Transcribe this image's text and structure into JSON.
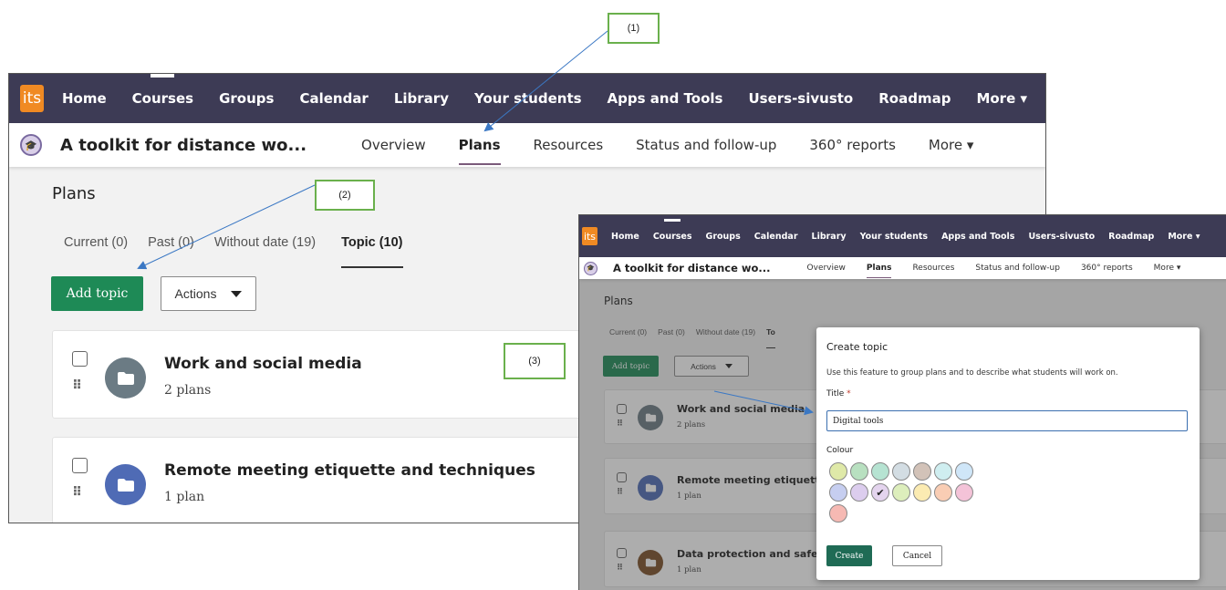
{
  "app": {
    "logo_text": "its",
    "nav": [
      "Home",
      "Courses",
      "Groups",
      "Calendar",
      "Library",
      "Your students",
      "Apps and Tools",
      "Users-sivusto",
      "Roadmap",
      "More ▾"
    ],
    "nav_active_index": 1,
    "course_title": "A toolkit for distance wo...",
    "course_nav": [
      "Overview",
      "Plans",
      "Resources",
      "Status and follow-up",
      "360° reports",
      "More ▾"
    ],
    "course_nav_active_index": 1,
    "page_heading": "Plans",
    "tabs": [
      "Current (0)",
      "Past (0)",
      "Without date (19)",
      "Topic (10)"
    ],
    "tabs_active_index": 3,
    "add_topic_label": "Add topic",
    "actions_label": "Actions",
    "topics": [
      {
        "title": "Work and social media",
        "count": "2 plans",
        "color": "#6b7b84"
      },
      {
        "title": "Remote meeting etiquette and techniques",
        "count": "1 plan",
        "color": "#4f6bb5"
      },
      {
        "title": "Data protection and safety",
        "count": "1 plan",
        "color": "#7a4e26"
      }
    ],
    "topics_dialog_view": [
      {
        "title": "Work and social media",
        "count": "2 plans"
      },
      {
        "title": "Remote meeting etiquette a",
        "count": "1 plan"
      },
      {
        "title": "Data protection and safety",
        "count": "1 plan"
      }
    ],
    "tabs_dialog_view": [
      "Current (0)",
      "Past (0)",
      "Without date (19)",
      "To"
    ]
  },
  "callouts": {
    "one": "(1)",
    "two": "(2)",
    "three": "(3)"
  },
  "dialog": {
    "title": "Create topic",
    "description": "Use this feature to group plans and to describe what students will work on.",
    "title_label": "Title",
    "required_mark": "*",
    "title_value": "Digital tools",
    "colour_label": "Colour",
    "swatch_colors": [
      "#dfe9a8",
      "#b8e0c0",
      "#b6e3d2",
      "#d3dde3",
      "#d2c2b8",
      "#cfeef0",
      "#cfe6f8",
      "#c6cef0",
      "#dccdee",
      "#e4d4ee",
      "#ddeebc",
      "#fbebb2",
      "#f9cdb4",
      "#f4c3d8",
      "#f6b9b3"
    ],
    "selected_swatch_index": 9,
    "check_mark": "✔",
    "create_label": "Create",
    "cancel_label": "Cancel"
  },
  "colors": {
    "topnav_bg": "#3d3b55",
    "logo_bg": "#f08a23",
    "primary_green": "#1e8a56",
    "callout_border": "#6ab04c",
    "arrow": "#3b78c4"
  }
}
